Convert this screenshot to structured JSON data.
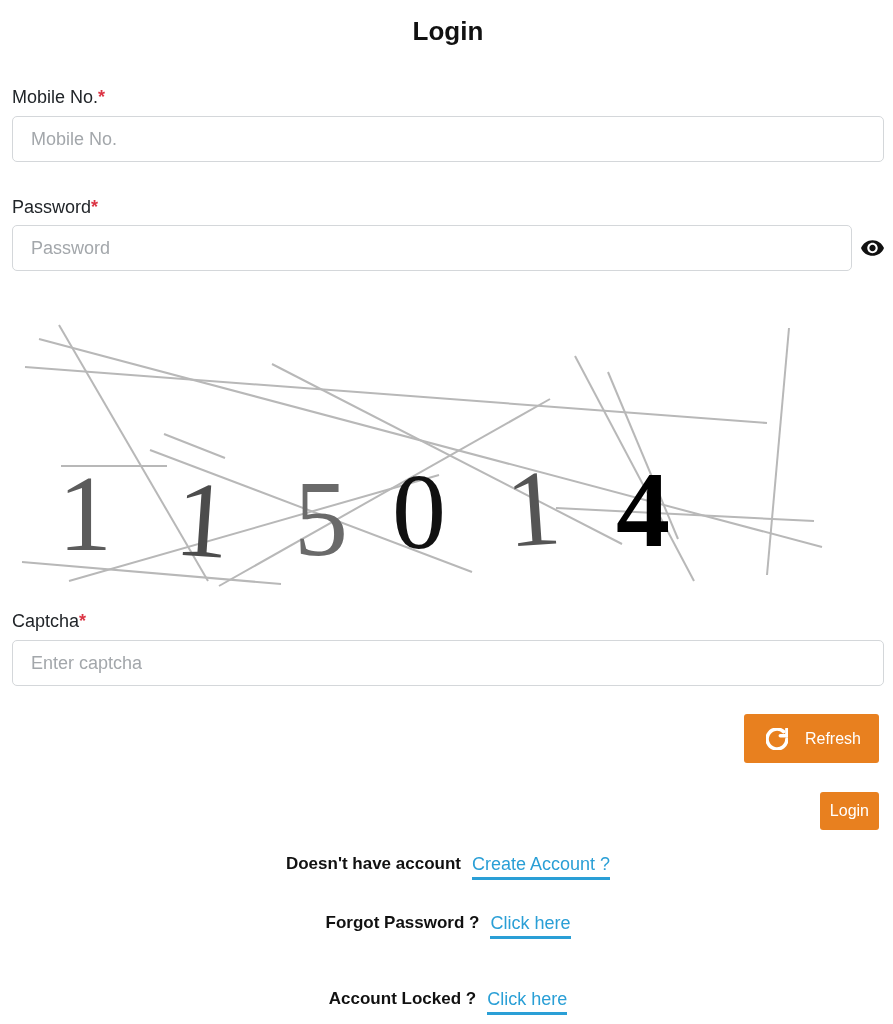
{
  "title": "Login",
  "fields": [
    {
      "label": "Mobile No.",
      "required_mark": "*",
      "placeholder": "Mobile No.",
      "kind": "text"
    },
    {
      "label": "Password",
      "required_mark": "*",
      "placeholder": "Password",
      "kind": "password"
    }
  ],
  "captcha": {
    "characters": [
      "1",
      "1",
      "5",
      "0",
      "1",
      "4"
    ],
    "label": "Captcha",
    "required_mark": "*",
    "placeholder": "Enter captcha"
  },
  "buttons": [
    {
      "label": "Refresh",
      "kind": "refresh"
    },
    {
      "label": "Login",
      "kind": "submit"
    }
  ],
  "links": [
    {
      "text": "Doesn't have account",
      "link": "Create Account ?"
    },
    {
      "text": "Forgot Password ?",
      "link": "Click here"
    },
    {
      "text": "Account Locked ?",
      "link": "Click here"
    }
  ]
}
